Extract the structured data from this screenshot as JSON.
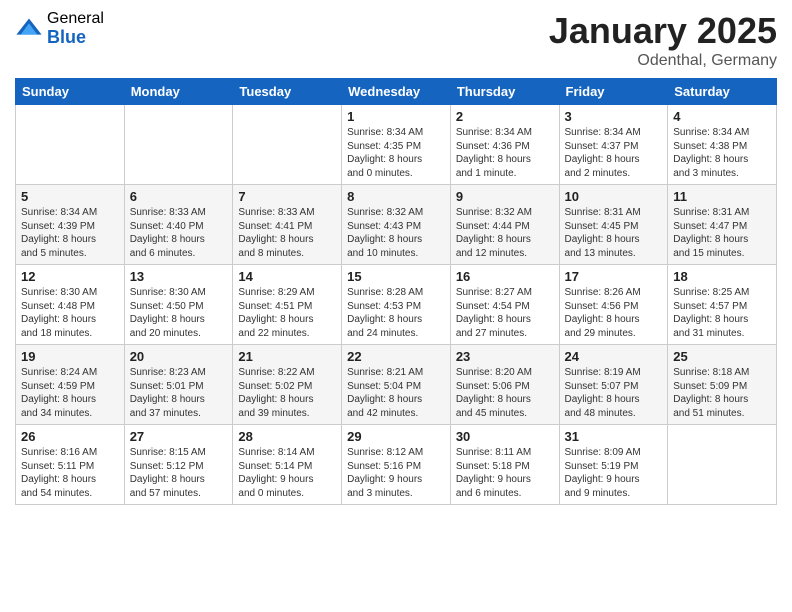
{
  "logo": {
    "general": "General",
    "blue": "Blue"
  },
  "header": {
    "month": "January 2025",
    "location": "Odenthal, Germany"
  },
  "weekdays": [
    "Sunday",
    "Monday",
    "Tuesday",
    "Wednesday",
    "Thursday",
    "Friday",
    "Saturday"
  ],
  "weeks": [
    [
      {
        "day": "",
        "info": ""
      },
      {
        "day": "",
        "info": ""
      },
      {
        "day": "",
        "info": ""
      },
      {
        "day": "1",
        "info": "Sunrise: 8:34 AM\nSunset: 4:35 PM\nDaylight: 8 hours\nand 0 minutes."
      },
      {
        "day": "2",
        "info": "Sunrise: 8:34 AM\nSunset: 4:36 PM\nDaylight: 8 hours\nand 1 minute."
      },
      {
        "day": "3",
        "info": "Sunrise: 8:34 AM\nSunset: 4:37 PM\nDaylight: 8 hours\nand 2 minutes."
      },
      {
        "day": "4",
        "info": "Sunrise: 8:34 AM\nSunset: 4:38 PM\nDaylight: 8 hours\nand 3 minutes."
      }
    ],
    [
      {
        "day": "5",
        "info": "Sunrise: 8:34 AM\nSunset: 4:39 PM\nDaylight: 8 hours\nand 5 minutes."
      },
      {
        "day": "6",
        "info": "Sunrise: 8:33 AM\nSunset: 4:40 PM\nDaylight: 8 hours\nand 6 minutes."
      },
      {
        "day": "7",
        "info": "Sunrise: 8:33 AM\nSunset: 4:41 PM\nDaylight: 8 hours\nand 8 minutes."
      },
      {
        "day": "8",
        "info": "Sunrise: 8:32 AM\nSunset: 4:43 PM\nDaylight: 8 hours\nand 10 minutes."
      },
      {
        "day": "9",
        "info": "Sunrise: 8:32 AM\nSunset: 4:44 PM\nDaylight: 8 hours\nand 12 minutes."
      },
      {
        "day": "10",
        "info": "Sunrise: 8:31 AM\nSunset: 4:45 PM\nDaylight: 8 hours\nand 13 minutes."
      },
      {
        "day": "11",
        "info": "Sunrise: 8:31 AM\nSunset: 4:47 PM\nDaylight: 8 hours\nand 15 minutes."
      }
    ],
    [
      {
        "day": "12",
        "info": "Sunrise: 8:30 AM\nSunset: 4:48 PM\nDaylight: 8 hours\nand 18 minutes."
      },
      {
        "day": "13",
        "info": "Sunrise: 8:30 AM\nSunset: 4:50 PM\nDaylight: 8 hours\nand 20 minutes."
      },
      {
        "day": "14",
        "info": "Sunrise: 8:29 AM\nSunset: 4:51 PM\nDaylight: 8 hours\nand 22 minutes."
      },
      {
        "day": "15",
        "info": "Sunrise: 8:28 AM\nSunset: 4:53 PM\nDaylight: 8 hours\nand 24 minutes."
      },
      {
        "day": "16",
        "info": "Sunrise: 8:27 AM\nSunset: 4:54 PM\nDaylight: 8 hours\nand 27 minutes."
      },
      {
        "day": "17",
        "info": "Sunrise: 8:26 AM\nSunset: 4:56 PM\nDaylight: 8 hours\nand 29 minutes."
      },
      {
        "day": "18",
        "info": "Sunrise: 8:25 AM\nSunset: 4:57 PM\nDaylight: 8 hours\nand 31 minutes."
      }
    ],
    [
      {
        "day": "19",
        "info": "Sunrise: 8:24 AM\nSunset: 4:59 PM\nDaylight: 8 hours\nand 34 minutes."
      },
      {
        "day": "20",
        "info": "Sunrise: 8:23 AM\nSunset: 5:01 PM\nDaylight: 8 hours\nand 37 minutes."
      },
      {
        "day": "21",
        "info": "Sunrise: 8:22 AM\nSunset: 5:02 PM\nDaylight: 8 hours\nand 39 minutes."
      },
      {
        "day": "22",
        "info": "Sunrise: 8:21 AM\nSunset: 5:04 PM\nDaylight: 8 hours\nand 42 minutes."
      },
      {
        "day": "23",
        "info": "Sunrise: 8:20 AM\nSunset: 5:06 PM\nDaylight: 8 hours\nand 45 minutes."
      },
      {
        "day": "24",
        "info": "Sunrise: 8:19 AM\nSunset: 5:07 PM\nDaylight: 8 hours\nand 48 minutes."
      },
      {
        "day": "25",
        "info": "Sunrise: 8:18 AM\nSunset: 5:09 PM\nDaylight: 8 hours\nand 51 minutes."
      }
    ],
    [
      {
        "day": "26",
        "info": "Sunrise: 8:16 AM\nSunset: 5:11 PM\nDaylight: 8 hours\nand 54 minutes."
      },
      {
        "day": "27",
        "info": "Sunrise: 8:15 AM\nSunset: 5:12 PM\nDaylight: 8 hours\nand 57 minutes."
      },
      {
        "day": "28",
        "info": "Sunrise: 8:14 AM\nSunset: 5:14 PM\nDaylight: 9 hours\nand 0 minutes."
      },
      {
        "day": "29",
        "info": "Sunrise: 8:12 AM\nSunset: 5:16 PM\nDaylight: 9 hours\nand 3 minutes."
      },
      {
        "day": "30",
        "info": "Sunrise: 8:11 AM\nSunset: 5:18 PM\nDaylight: 9 hours\nand 6 minutes."
      },
      {
        "day": "31",
        "info": "Sunrise: 8:09 AM\nSunset: 5:19 PM\nDaylight: 9 hours\nand 9 minutes."
      },
      {
        "day": "",
        "info": ""
      }
    ]
  ]
}
